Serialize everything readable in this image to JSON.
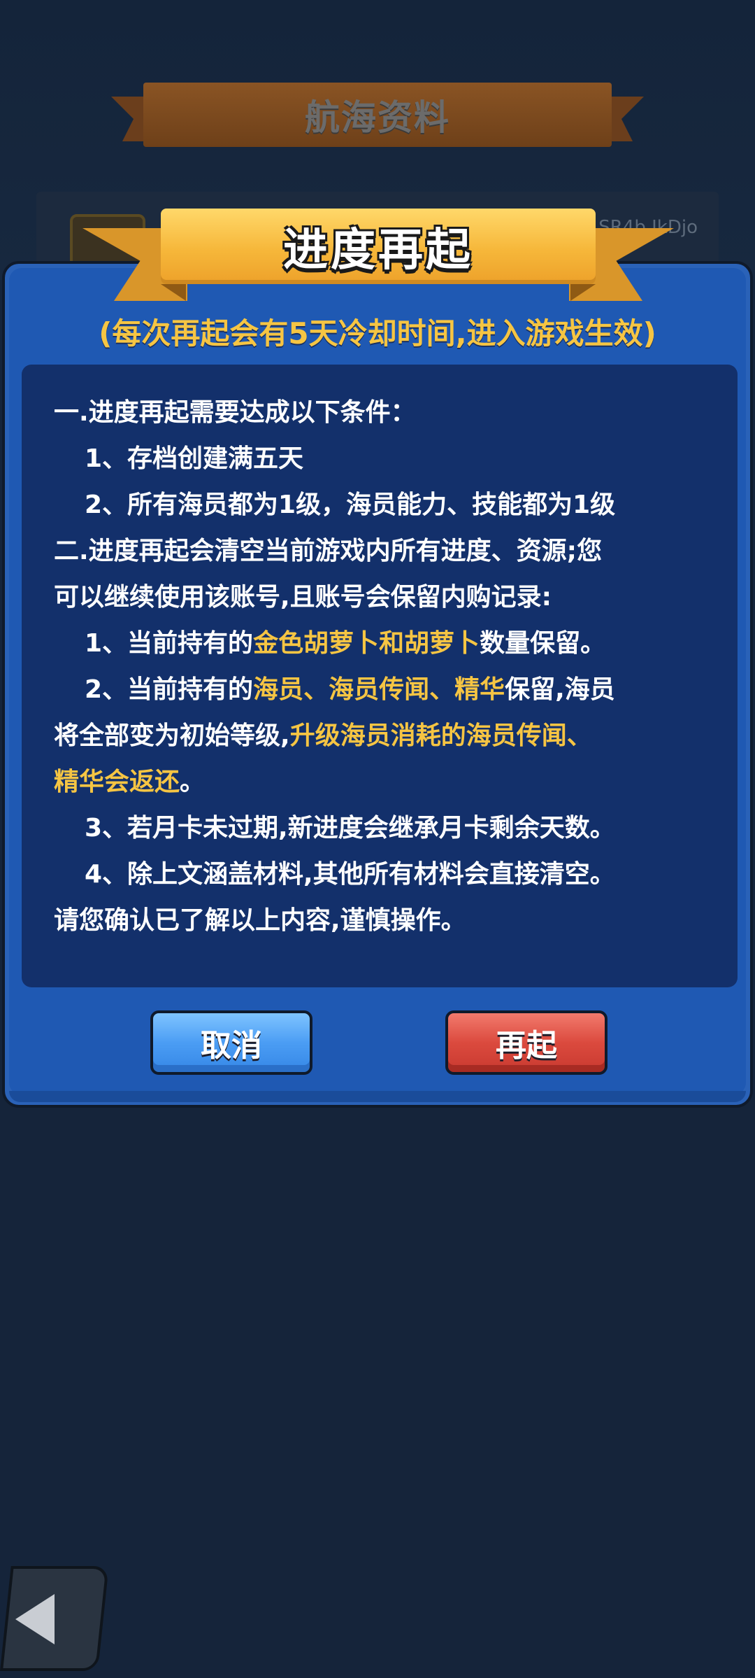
{
  "background": {
    "header_title": "航海资料",
    "card_id": "SR4b IkDjo"
  },
  "dialog": {
    "title": "进度再起",
    "subtitle": "(每次再起会有5天冷却时间,进入游戏生效)",
    "lines": [
      {
        "segments": [
          {
            "text": "一.进度再起需要达成以下条件："
          }
        ]
      },
      {
        "segments": [
          {
            "text": "1、存档创建满五天"
          }
        ]
      },
      {
        "segments": [
          {
            "text": "2、所有海员都为1级，海员能力、技能都为1级"
          }
        ]
      },
      {
        "segments": [
          {
            "text": "二.进度再起会清空当前游戏内所有进度、资源;您"
          }
        ]
      },
      {
        "segments": [
          {
            "text": "可以继续使用该账号,且账号会保留内购记录:"
          }
        ]
      },
      {
        "segments": [
          {
            "text": "1、当前持有的"
          },
          {
            "text": "金色胡萝卜和胡萝卜"
          },
          {
            "text": "数量保留。"
          }
        ]
      },
      {
        "segments": [
          {
            "text": "2、当前持有的"
          },
          {
            "text": "海员、海员传闻、精华"
          },
          {
            "text": "保留,海员"
          }
        ]
      },
      {
        "segments": [
          {
            "text": "将全部变为初始等级,"
          },
          {
            "text": "升级海员消耗的海员传闻、"
          }
        ]
      },
      {
        "segments": [
          {
            "text": "精华会返还"
          },
          {
            "text": "。"
          }
        ]
      },
      {
        "segments": [
          {
            "text": "3、若月卡未过期,新进度会继承月卡剩余天数。"
          }
        ]
      },
      {
        "segments": [
          {
            "text": "4、除上文涵盖材料,其他所有材料会直接清空。"
          }
        ]
      },
      {
        "segments": [
          {
            "text": "请您确认已了解以上内容,谨慎操作。"
          }
        ]
      }
    ],
    "cancel_label": "取消",
    "confirm_label": "再起"
  },
  "colors": {
    "highlight": "#f6c543",
    "dialog_blue": "#1f59b3",
    "content_bg": "#13306b",
    "cancel_blue": "#4b9df4",
    "confirm_red": "#db4a3e"
  },
  "icons": {
    "back": "back-arrow-icon"
  }
}
